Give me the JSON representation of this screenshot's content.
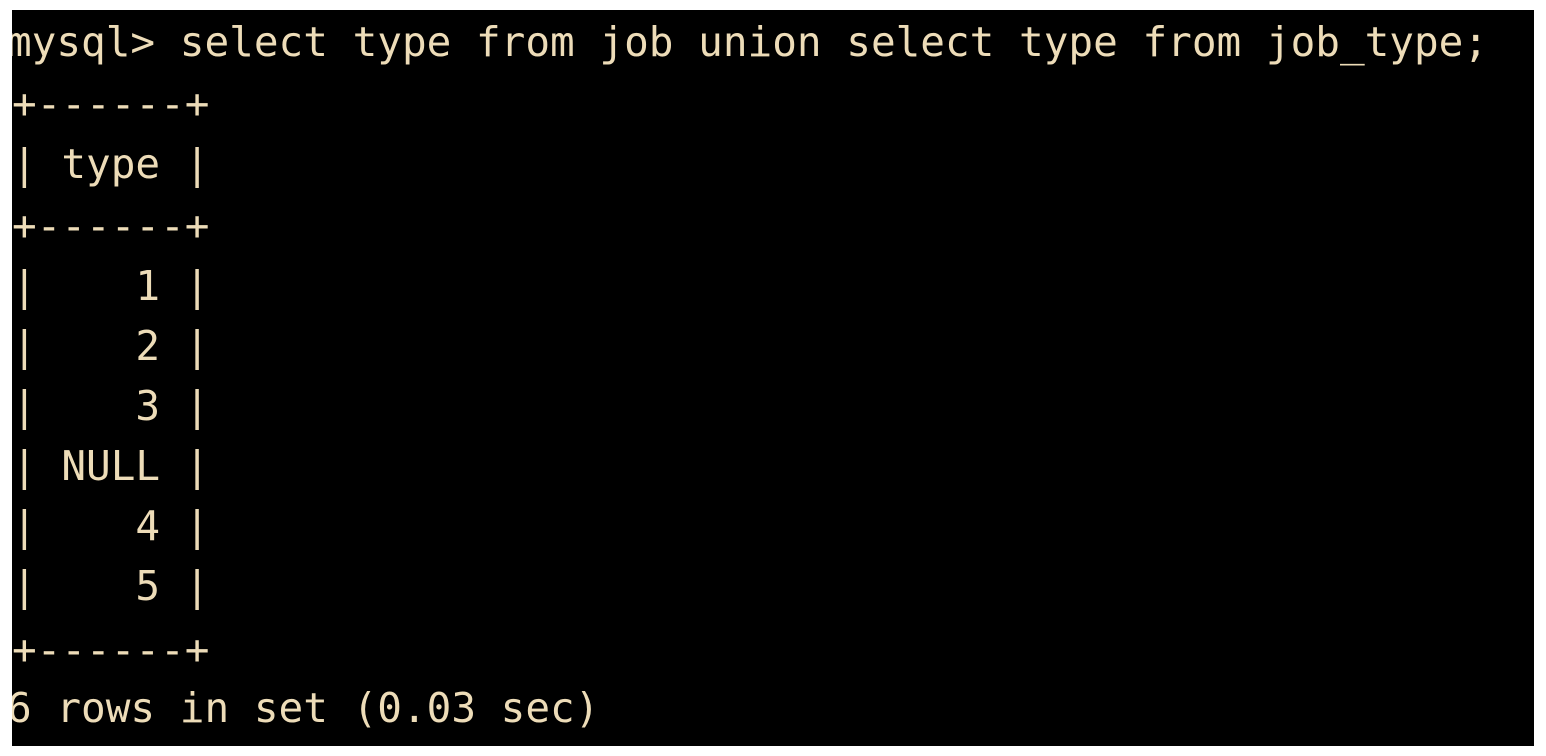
{
  "terminal": {
    "prompt_command": "mysql> select type from job union select type from job_type;",
    "border_line": "+------+",
    "header_line": "| type |",
    "rows": [
      "|    1 |",
      "|    2 |",
      "|    3 |",
      "| NULL |",
      "|    4 |",
      "|    5 |"
    ],
    "status": "6 rows in set (0.03 sec)",
    "colors": {
      "background": "#000000",
      "text": "#eddcb8"
    }
  }
}
